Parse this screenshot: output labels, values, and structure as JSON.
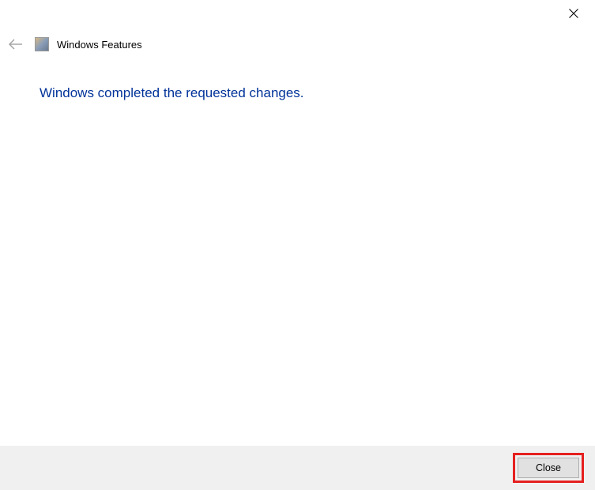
{
  "titlebar": {
    "close_icon": "close"
  },
  "header": {
    "back_icon": "back-arrow",
    "app_title": "Windows Features"
  },
  "main": {
    "message": "Windows completed the requested changes."
  },
  "footer": {
    "close_label": "Close"
  },
  "colors": {
    "message_text": "#003399",
    "highlight_border": "#e62020",
    "footer_bg": "#f0f0f0"
  }
}
